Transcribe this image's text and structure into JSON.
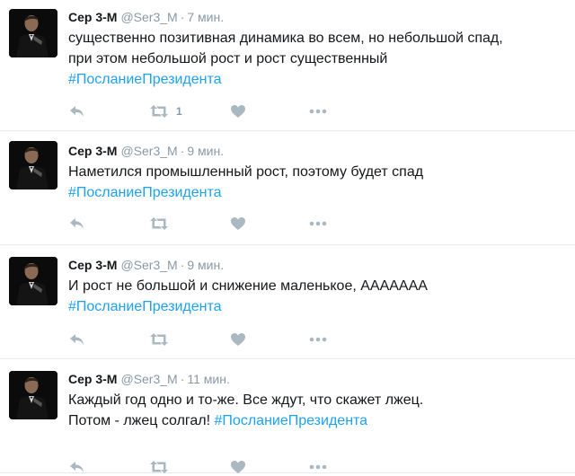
{
  "tweets": [
    {
      "name": "Сер 3-М",
      "handle": "@Ser3_M",
      "time": "7 мин.",
      "lines": [
        {
          "text": "существенно позитивная динамика во всем, но небольшой спад,",
          "hashtag": ""
        },
        {
          "text": "при этом небольшой рост и рост существенный",
          "hashtag": ""
        },
        {
          "text": "",
          "hashtag": "#ПосланиеПрезидента"
        }
      ],
      "retweets": "1"
    },
    {
      "name": "Сер 3-М",
      "handle": "@Ser3_M",
      "time": "9 мин.",
      "lines": [
        {
          "text": "Наметился промышленный рост, поэтому будет спад",
          "hashtag": ""
        },
        {
          "text": "",
          "hashtag": "#ПосланиеПрезидента"
        }
      ],
      "retweets": ""
    },
    {
      "name": "Сер 3-М",
      "handle": "@Ser3_M",
      "time": "9 мин.",
      "lines": [
        {
          "text": "И рост не большой и снижение маленькое, ААААААА",
          "hashtag": ""
        },
        {
          "text": "",
          "hashtag": "#ПосланиеПрезидента"
        }
      ],
      "retweets": ""
    },
    {
      "name": "Сер 3-М",
      "handle": "@Ser3_M",
      "time": "11 мин.",
      "lines": [
        {
          "text": "Каждый год одно и то-же. Все ждут, что скажет лжец.",
          "hashtag": ""
        },
        {
          "text": "Потом - лжец солгал! ",
          "hashtag": "#ПосланиеПрезидента"
        }
      ],
      "retweets": ""
    }
  ],
  "separator": "·",
  "icons": {
    "reply": "reply-icon",
    "retweet": "retweet-icon",
    "like": "heart-icon",
    "more": "more-dots-icon"
  },
  "colors": {
    "hashtag": "#1da1f2",
    "muted": "#8899a6",
    "icon": "#aab8c2",
    "text": "#14171a",
    "divider": "#e6ecf0"
  }
}
